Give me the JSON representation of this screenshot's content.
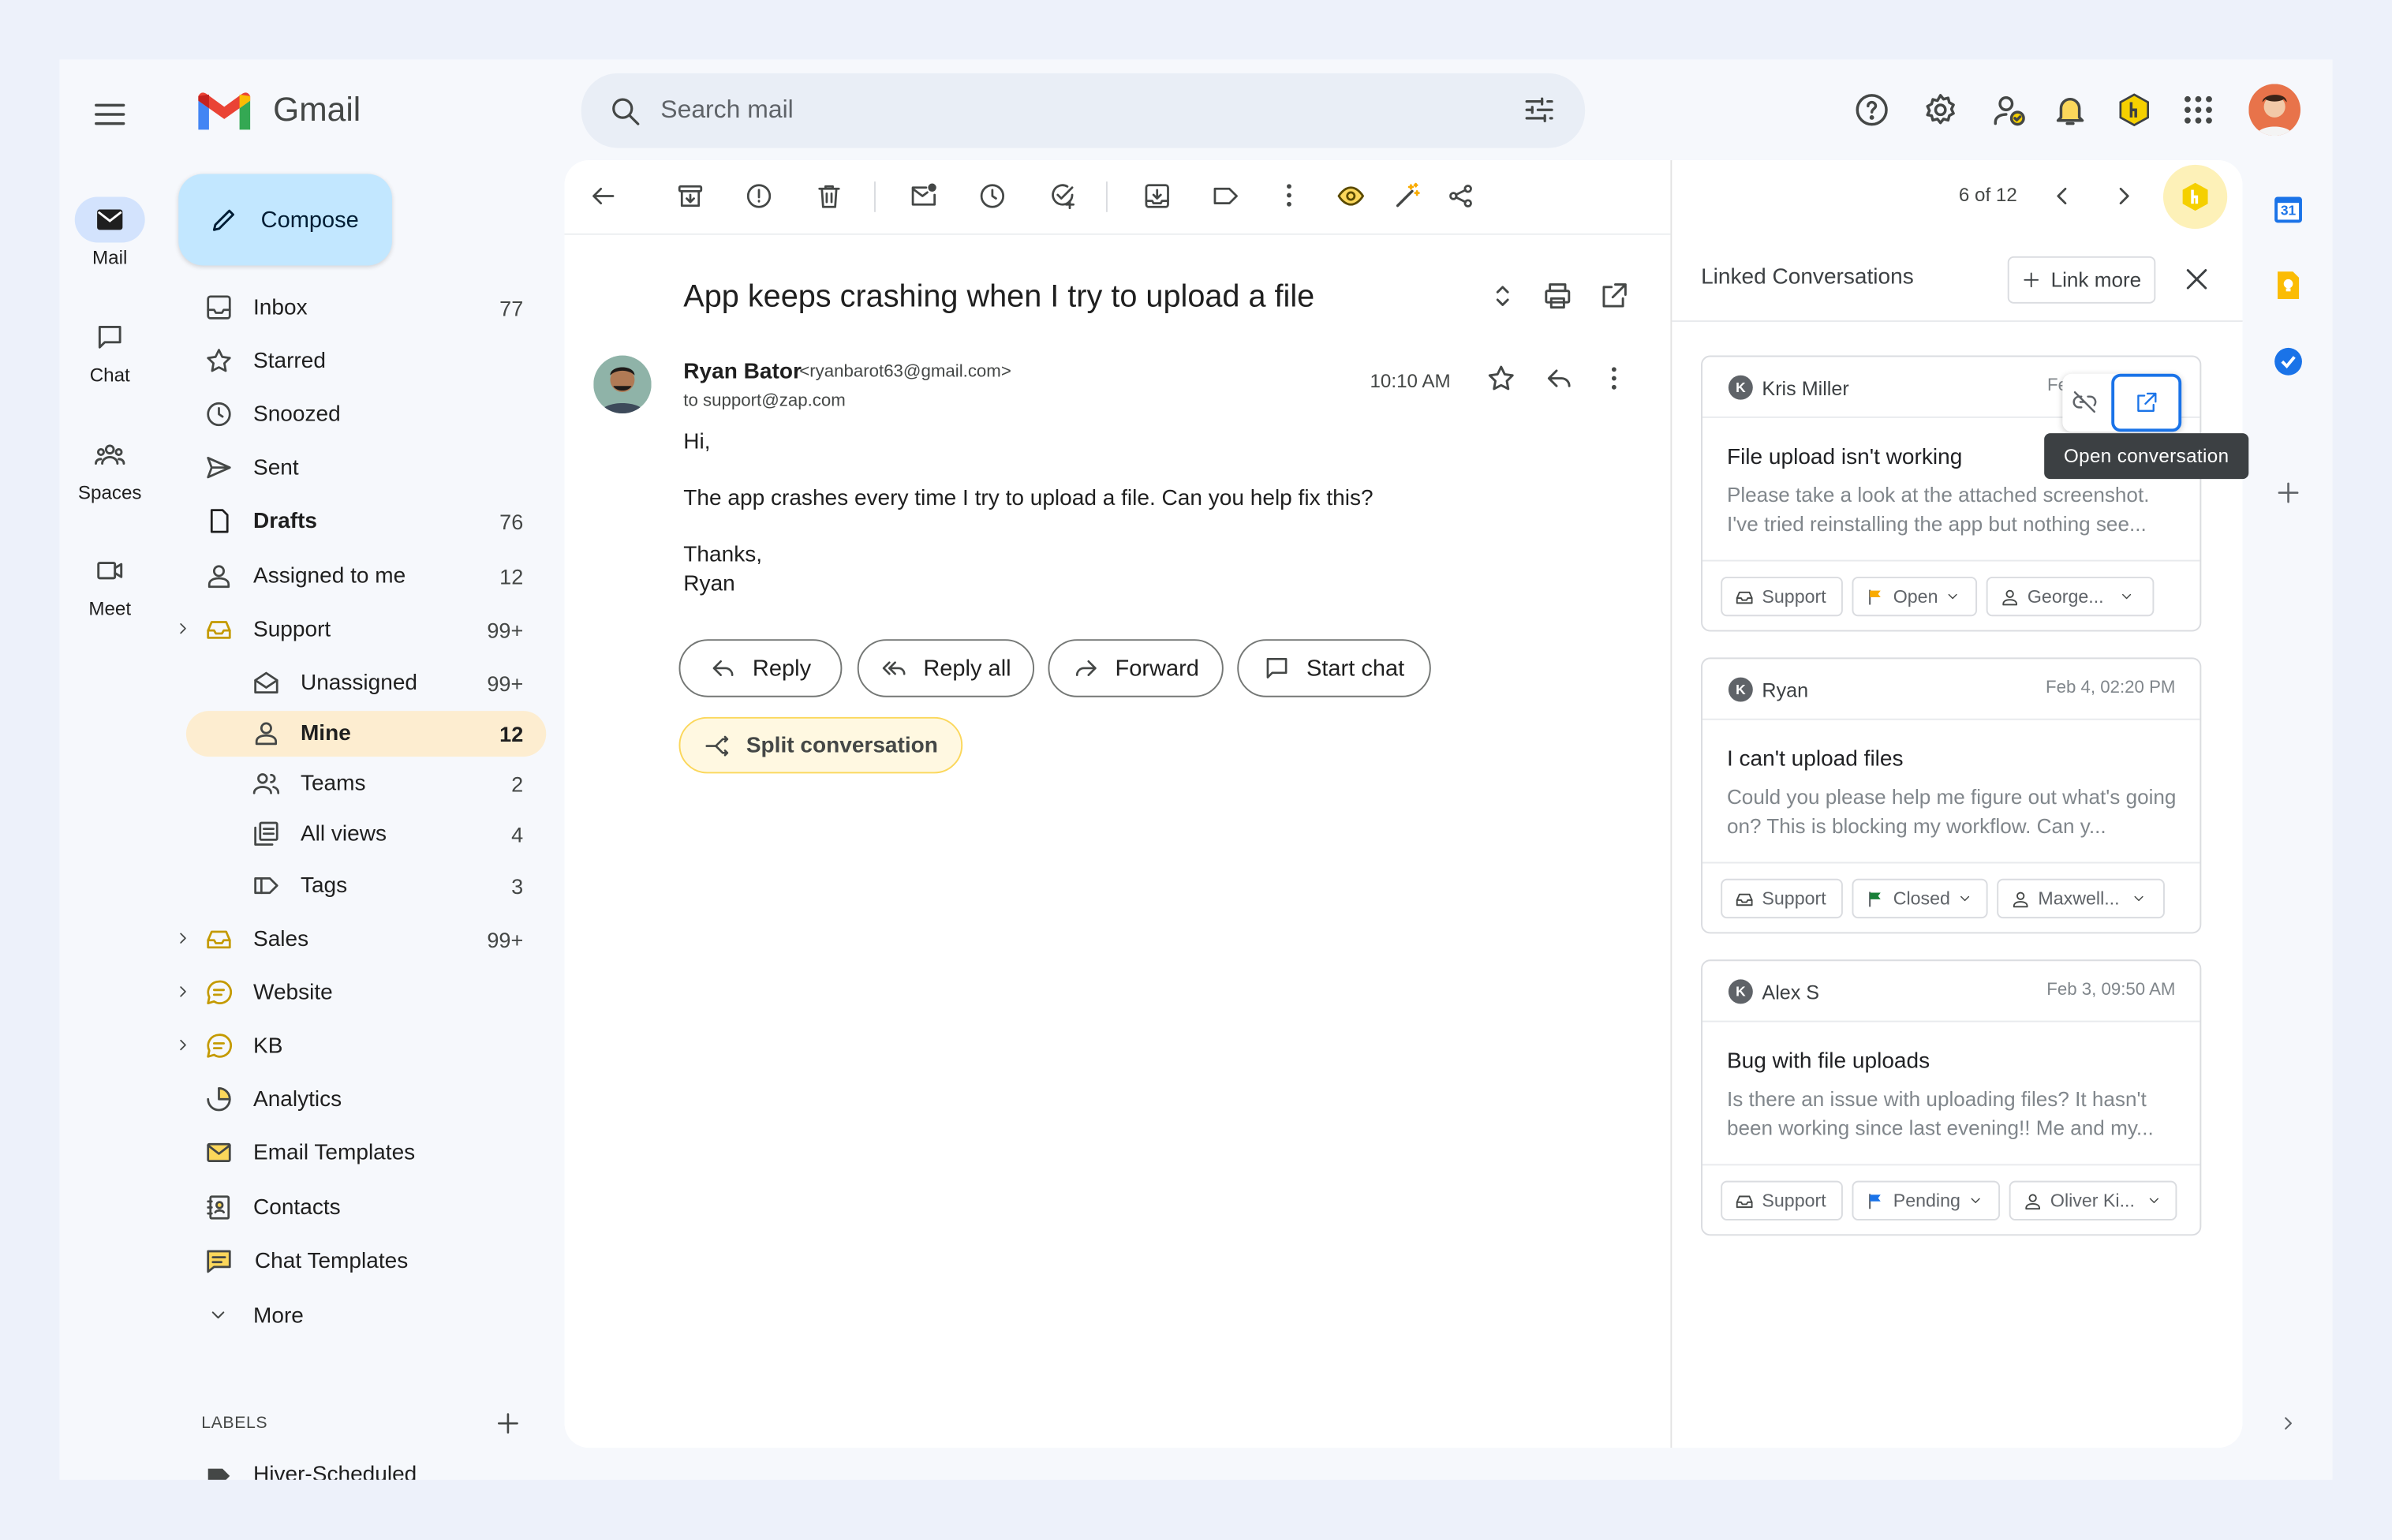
{
  "app": {
    "name": "Gmail"
  },
  "rail": {
    "items": [
      {
        "label": "Mail",
        "icon": "mail-icon"
      },
      {
        "label": "Chat",
        "icon": "chat-icon"
      },
      {
        "label": "Spaces",
        "icon": "spaces-icon"
      },
      {
        "label": "Meet",
        "icon": "meet-icon"
      }
    ]
  },
  "sidebar": {
    "compose": "Compose",
    "items": [
      {
        "label": "Inbox",
        "count": "77",
        "icon": "inbox-icon"
      },
      {
        "label": "Starred",
        "count": "",
        "icon": "star-icon"
      },
      {
        "label": "Snoozed",
        "count": "",
        "icon": "clock-icon"
      },
      {
        "label": "Sent",
        "count": "",
        "icon": "send-icon"
      },
      {
        "label": "Drafts",
        "count": "76",
        "icon": "draft-icon"
      },
      {
        "label": "Assigned to me",
        "count": "12",
        "icon": "person-icon"
      },
      {
        "label": "Support",
        "count": "99+",
        "icon": "shared-inbox-icon"
      },
      {
        "label": "Unassigned",
        "count": "99+",
        "icon": "open-envelope-icon"
      },
      {
        "label": "Mine",
        "count": "12",
        "icon": "person-icon"
      },
      {
        "label": "Teams",
        "count": "2",
        "icon": "team-icon"
      },
      {
        "label": "All views",
        "count": "4",
        "icon": "views-icon"
      },
      {
        "label": "Tags",
        "count": "3",
        "icon": "tag-icon"
      },
      {
        "label": "Sales",
        "count": "99+",
        "icon": "shared-inbox-icon"
      },
      {
        "label": "Website",
        "count": "",
        "icon": "chat-bubble-icon"
      },
      {
        "label": "KB",
        "count": "",
        "icon": "chat-bubble-icon"
      },
      {
        "label": "Analytics",
        "count": "",
        "icon": "analytics-icon"
      },
      {
        "label": "Email Templates",
        "count": "",
        "icon": "email-template-icon"
      },
      {
        "label": "Contacts",
        "count": "",
        "icon": "contacts-icon"
      },
      {
        "label": "Chat Templates",
        "count": "",
        "icon": "chat-template-icon"
      },
      {
        "label": "More",
        "count": "",
        "icon": "chevron-down-icon"
      }
    ],
    "labels_heading": "LABELS",
    "label_items": [
      {
        "label": "Hiver-Scheduled"
      }
    ]
  },
  "search": {
    "placeholder": "Search mail"
  },
  "toolbar": {
    "pagination": "6 of 12"
  },
  "email": {
    "subject": "App keeps crashing when I try to upload a file",
    "sender_name": "Ryan Bator",
    "sender_email": "<ryanbarot63@gmail.com>",
    "to": "to support@zap.com",
    "time": "10:10 AM",
    "body": {
      "greeting": "Hi,",
      "line": "The app crashes every time I try to upload a file. Can you help fix this?",
      "signoff": "Thanks,",
      "signature": "Ryan"
    },
    "actions": {
      "reply": "Reply",
      "reply_all": "Reply all",
      "forward": "Forward",
      "start_chat": "Start chat",
      "split": "Split conversation"
    }
  },
  "linked": {
    "title": "Linked Conversations",
    "link_more": "Link more",
    "tooltip": "Open conversation",
    "cards": [
      {
        "name": "Kris Miller",
        "avatar": "K",
        "date": "Fe",
        "title": "File upload isn't working",
        "preview": "Please take a look at the attached screenshot. I've tried reinstalling the app but nothing see...",
        "inbox": "Support",
        "status": "Open",
        "status_color": "#f9ab00",
        "assignee": "George..."
      },
      {
        "name": "Ryan",
        "avatar": "K",
        "date": "Feb 4, 02:20 PM",
        "title": "I can't upload files",
        "preview": "Could you please help me figure out what's going on? This is blocking my workflow. Can y...",
        "inbox": "Support",
        "status": "Closed",
        "status_color": "#188038",
        "assignee": "Maxwell..."
      },
      {
        "name": "Alex S",
        "avatar": "K",
        "date": "Feb 3, 09:50 AM",
        "title": "Bug with file uploads",
        "preview": "Is there an issue with uploading files? It hasn't been working since last evening!! Me and my...",
        "inbox": "Support",
        "status": "Pending",
        "status_color": "#1a73e8",
        "assignee": "Oliver Ki..."
      }
    ]
  },
  "side_apps": {
    "calendar_day": "31"
  },
  "colors": {
    "accent": "#c2e7ff",
    "selected": "#fdedd0",
    "hiver": "#f5d000",
    "split": "#fff8e1"
  }
}
